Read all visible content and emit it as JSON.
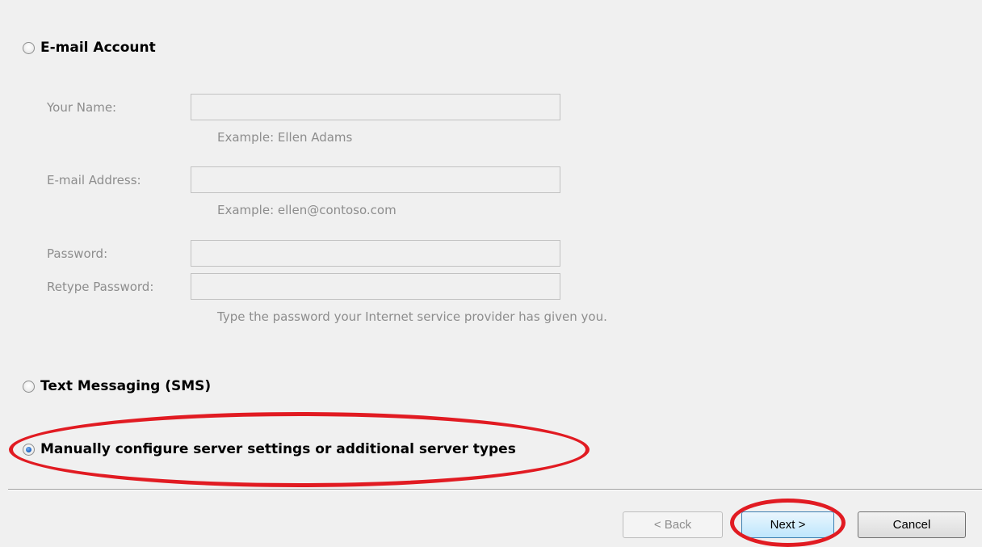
{
  "email_account": {
    "option_label": "E-mail Account",
    "fields": {
      "your_name": {
        "label": "Your Name:",
        "value": "",
        "hint": "Example: Ellen Adams"
      },
      "email_address": {
        "label": "E-mail Address:",
        "value": "",
        "hint": "Example: ellen@contoso.com"
      },
      "password": {
        "label": "Password:",
        "value": ""
      },
      "retype_password": {
        "label": "Retype Password:",
        "value": "",
        "hint": "Type the password your Internet service provider has given you."
      }
    }
  },
  "text_messaging": {
    "option_label": "Text Messaging (SMS)"
  },
  "manual_config": {
    "option_label": "Manually configure server settings or additional server types",
    "selected": true
  },
  "buttons": {
    "back": "< Back",
    "next": "Next >",
    "cancel": "Cancel"
  },
  "annotation_color": "#e11b22"
}
